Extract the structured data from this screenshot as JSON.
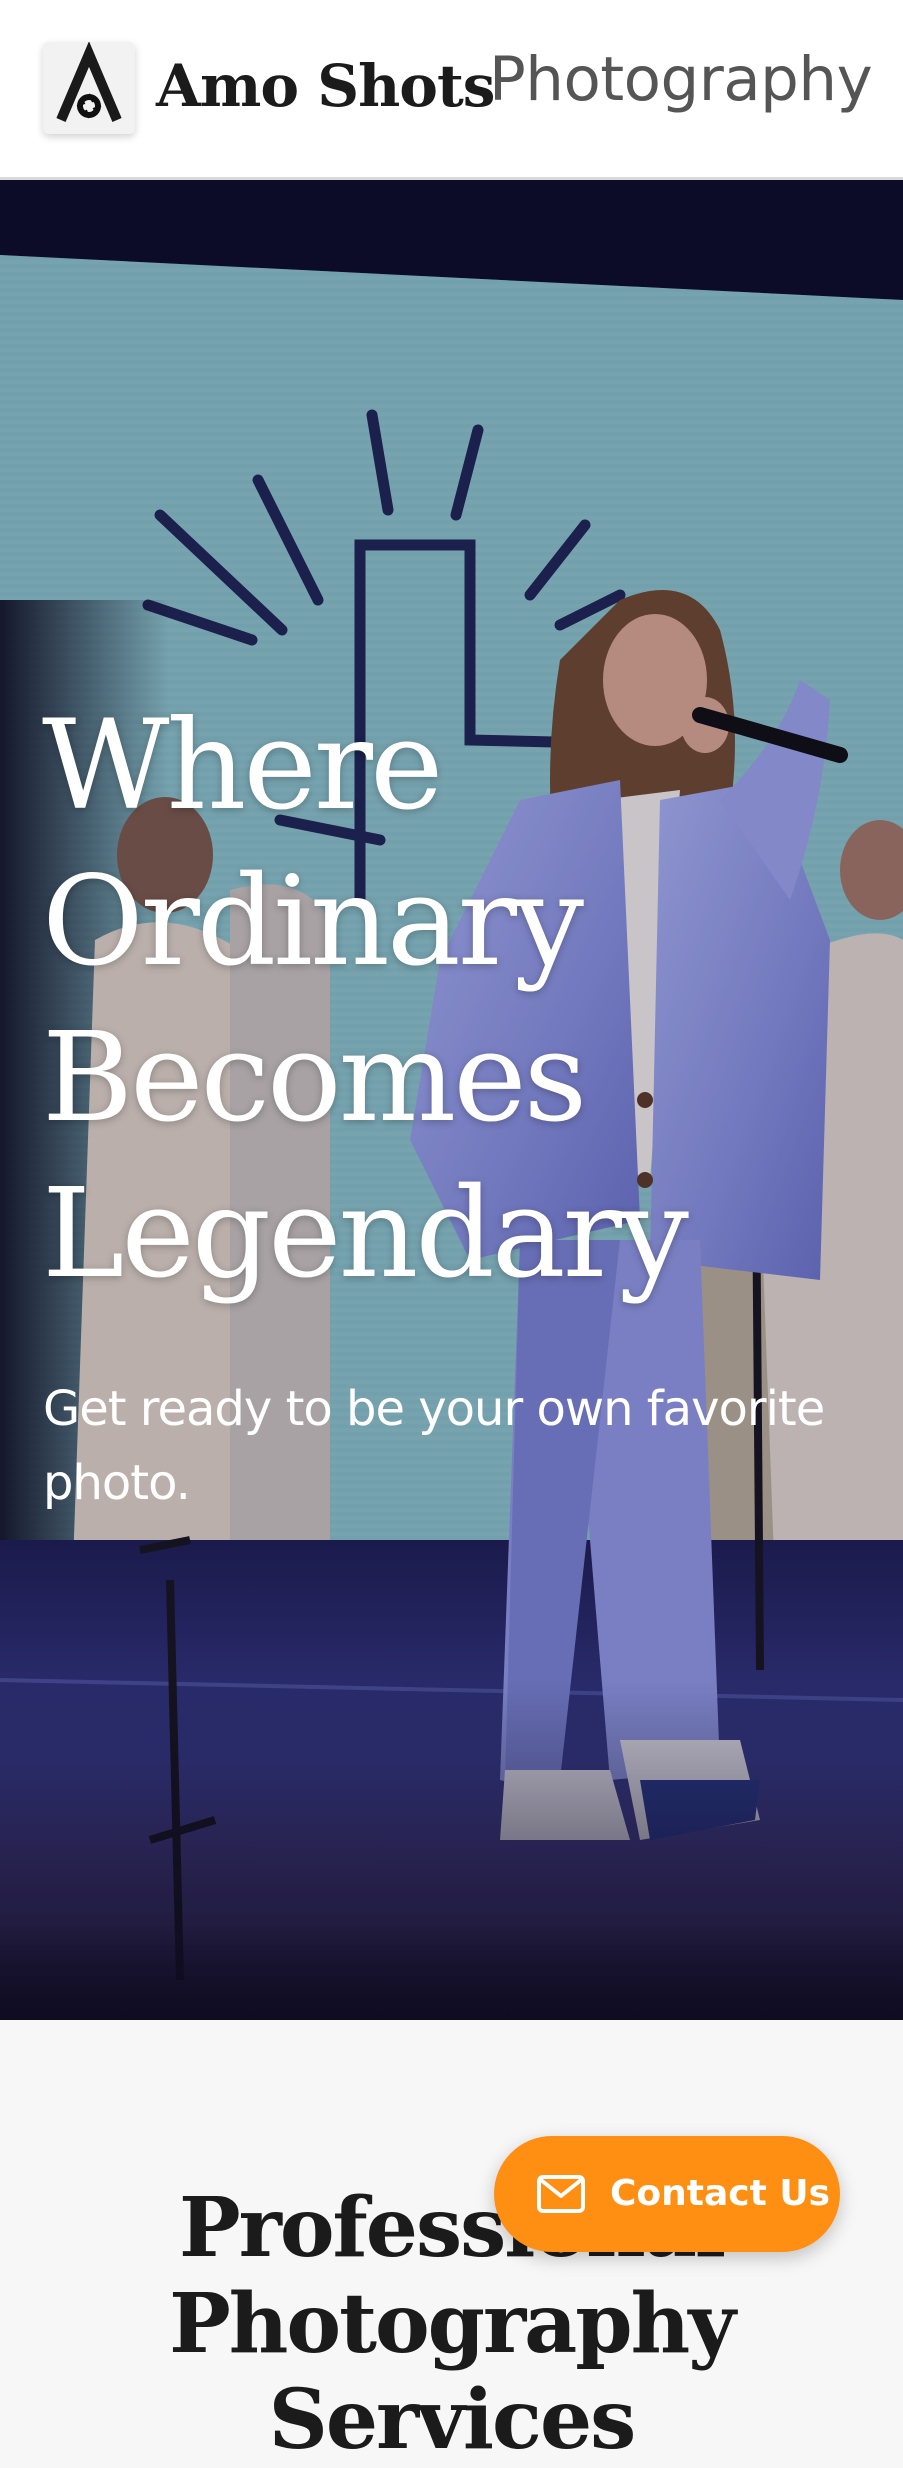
{
  "header": {
    "brand_bold": "Amo Shots",
    "brand_light": "Photography",
    "logo_icon": "camera-aperture-logo-icon"
  },
  "hero": {
    "heading_lines": [
      "Where",
      "Ordinary",
      "Becomes",
      "Legendary"
    ],
    "subheading": "Get ready to be your own favorite photo.",
    "photo": "concert-singer-photo"
  },
  "section": {
    "title": "Professional Photography Services"
  },
  "contact": {
    "label": "Contact Us",
    "icon": "mail-icon"
  },
  "colors": {
    "accent": "#ff8f12",
    "header_bg": "#ffffff",
    "hero_text": "#ffffff",
    "page_bg": "#f7f7f7"
  }
}
